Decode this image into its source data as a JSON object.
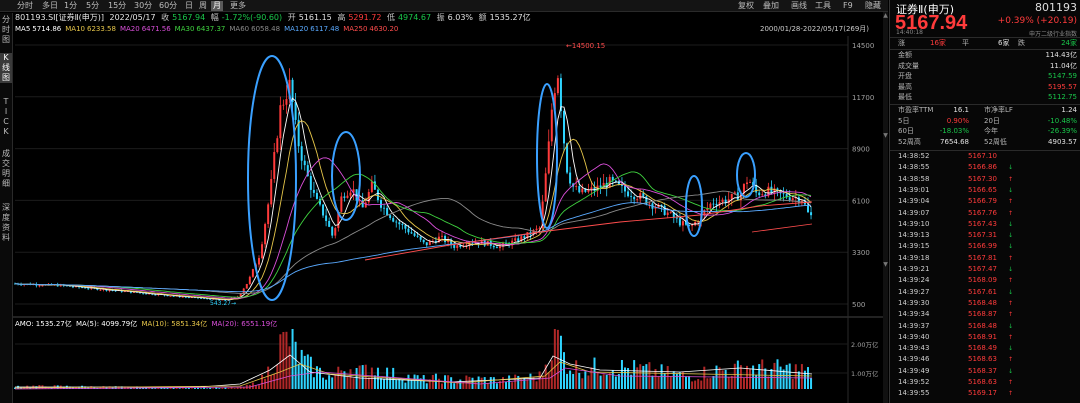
{
  "toolbar": {
    "tabs": [
      "分时",
      "多日",
      "1分",
      "5分",
      "15分",
      "30分",
      "60分",
      "日",
      "周",
      "月",
      "更多"
    ],
    "active_tab": 9,
    "right_tabs": [
      "复权",
      "叠加",
      "画线",
      "工具",
      "F9",
      "隐藏"
    ]
  },
  "rail": [
    "分\n时\n图",
    "K\n线\n图",
    "T\nI\nC\nK",
    "成\n交\n明\n细",
    "深\n度\n资\n料"
  ],
  "info": {
    "name": "801193.SI[证券Ⅱ(申万)]",
    "date": "2022/05/17",
    "close_label": "收",
    "close": "5167.94",
    "chg_label": "幅",
    "chg": "-1.72%(-90.60)",
    "open_label": "开",
    "open": "5161.15",
    "high_label": "高",
    "high": "5291.72",
    "low_label": "低",
    "low": "4974.67",
    "amp_label": "振",
    "amp": "6.03%",
    "amt_label": "额",
    "amt": "1535.27亿"
  },
  "ma": [
    {
      "label": "MA5",
      "value": "5714.86",
      "color": "#ffffff"
    },
    {
      "label": "MA10",
      "value": "6233.58",
      "color": "#e6c64a"
    },
    {
      "label": "MA20",
      "value": "6471.56",
      "color": "#d94fd9"
    },
    {
      "label": "MA30",
      "value": "6437.37",
      "color": "#3fd13f"
    },
    {
      "label": "MA60",
      "value": "6058.48",
      "color": "#8a8a8a"
    },
    {
      "label": "MA120",
      "value": "6117.48",
      "color": "#5aaaff"
    },
    {
      "label": "MA250",
      "value": "4630.20",
      "color": "#ff4d4d"
    }
  ],
  "date_range": "2000/01/28-2022/05/17(269月)",
  "yaxis": [
    "14500",
    "11700",
    "8900",
    "6100",
    "3300",
    "500"
  ],
  "peak_label": "14500.15",
  "low_label": "543.27",
  "amo": {
    "label": "AMO: 1535.27亿",
    "ma5": "MA(5): 4099.79亿",
    "ma10": "MA(10): 5851.34亿",
    "ma20": "MA(20): 6551.19亿"
  },
  "vol_axis": [
    "2.00万亿",
    "1.00万亿"
  ],
  "right": {
    "name": "证券Ⅱ(申万)",
    "code": "801193",
    "price": "5167.94",
    "change": "+0.39% (+20.19)",
    "time": "14:40:18",
    "index_label": "申万二级行业指数",
    "breadth": {
      "up_label": "涨",
      "up": "16家",
      "flat_label": "平",
      "flat": "6家",
      "down_label": "跌",
      "down": "24家"
    },
    "stats": [
      {
        "label": "金额",
        "value": "114.43亿",
        "cls": "wh"
      },
      {
        "label": "成交量",
        "value": "11.04亿",
        "cls": "wh"
      },
      {
        "label": "开盘",
        "value": "5147.59",
        "cls": "dn"
      },
      {
        "label": "最高",
        "value": "5195.57",
        "cls": "up"
      },
      {
        "label": "最低",
        "value": "5112.75",
        "cls": "dn"
      }
    ],
    "stats2": [
      {
        "l1": "市盈率TTM",
        "v1": "16.1",
        "c1": "wh",
        "l2": "市净率LF",
        "v2": "1.24",
        "c2": "wh"
      },
      {
        "l1": "5日",
        "v1": "0.90%",
        "c1": "up",
        "l2": "20日",
        "v2": "-10.48%",
        "c2": "dn"
      },
      {
        "l1": "60日",
        "v1": "-18.03%",
        "c1": "dn",
        "l2": "今年",
        "v2": "-26.39%",
        "c2": "dn"
      },
      {
        "l1": "52周高",
        "v1": "7654.68",
        "c1": "wh",
        "l2": "52周低",
        "v2": "4903.57",
        "c2": "wh"
      }
    ],
    "ticks": [
      {
        "time": "14:38:52",
        "price": "5167.10",
        "arrow": ""
      },
      {
        "time": "14:38:55",
        "price": "5166.86",
        "arrow": "↓"
      },
      {
        "time": "14:38:58",
        "price": "5167.30",
        "arrow": "↑"
      },
      {
        "time": "14:39:01",
        "price": "5166.65",
        "arrow": "↓"
      },
      {
        "time": "14:39:04",
        "price": "5166.79",
        "arrow": "↑"
      },
      {
        "time": "14:39:07",
        "price": "5167.76",
        "arrow": "↑"
      },
      {
        "time": "14:39:10",
        "price": "5167.43",
        "arrow": "↓"
      },
      {
        "time": "14:39:13",
        "price": "5167.31",
        "arrow": "↓"
      },
      {
        "time": "14:39:15",
        "price": "5166.99",
        "arrow": "↓"
      },
      {
        "time": "14:39:18",
        "price": "5167.81",
        "arrow": "↑"
      },
      {
        "time": "14:39:21",
        "price": "5167.47",
        "arrow": "↓"
      },
      {
        "time": "14:39:24",
        "price": "5168.09",
        "arrow": "↑"
      },
      {
        "time": "14:39:27",
        "price": "5167.61",
        "arrow": "↓"
      },
      {
        "time": "14:39:30",
        "price": "5168.48",
        "arrow": "↑"
      },
      {
        "time": "14:39:34",
        "price": "5168.87",
        "arrow": "↑"
      },
      {
        "time": "14:39:37",
        "price": "5168.48",
        "arrow": "↓"
      },
      {
        "time": "14:39:40",
        "price": "5168.91",
        "arrow": "↑"
      },
      {
        "time": "14:39:43",
        "price": "5168.49",
        "arrow": "↓"
      },
      {
        "time": "14:39:46",
        "price": "5168.63",
        "arrow": "↑"
      },
      {
        "time": "14:39:49",
        "price": "5168.37",
        "arrow": "↓"
      },
      {
        "time": "14:39:52",
        "price": "5168.63",
        "arrow": "↑"
      },
      {
        "time": "14:39:55",
        "price": "5169.17",
        "arrow": "↑"
      }
    ]
  },
  "colors": {
    "up": "#ff3b3b",
    "down": "#19c64a",
    "circle": "#3aa0ff"
  }
}
